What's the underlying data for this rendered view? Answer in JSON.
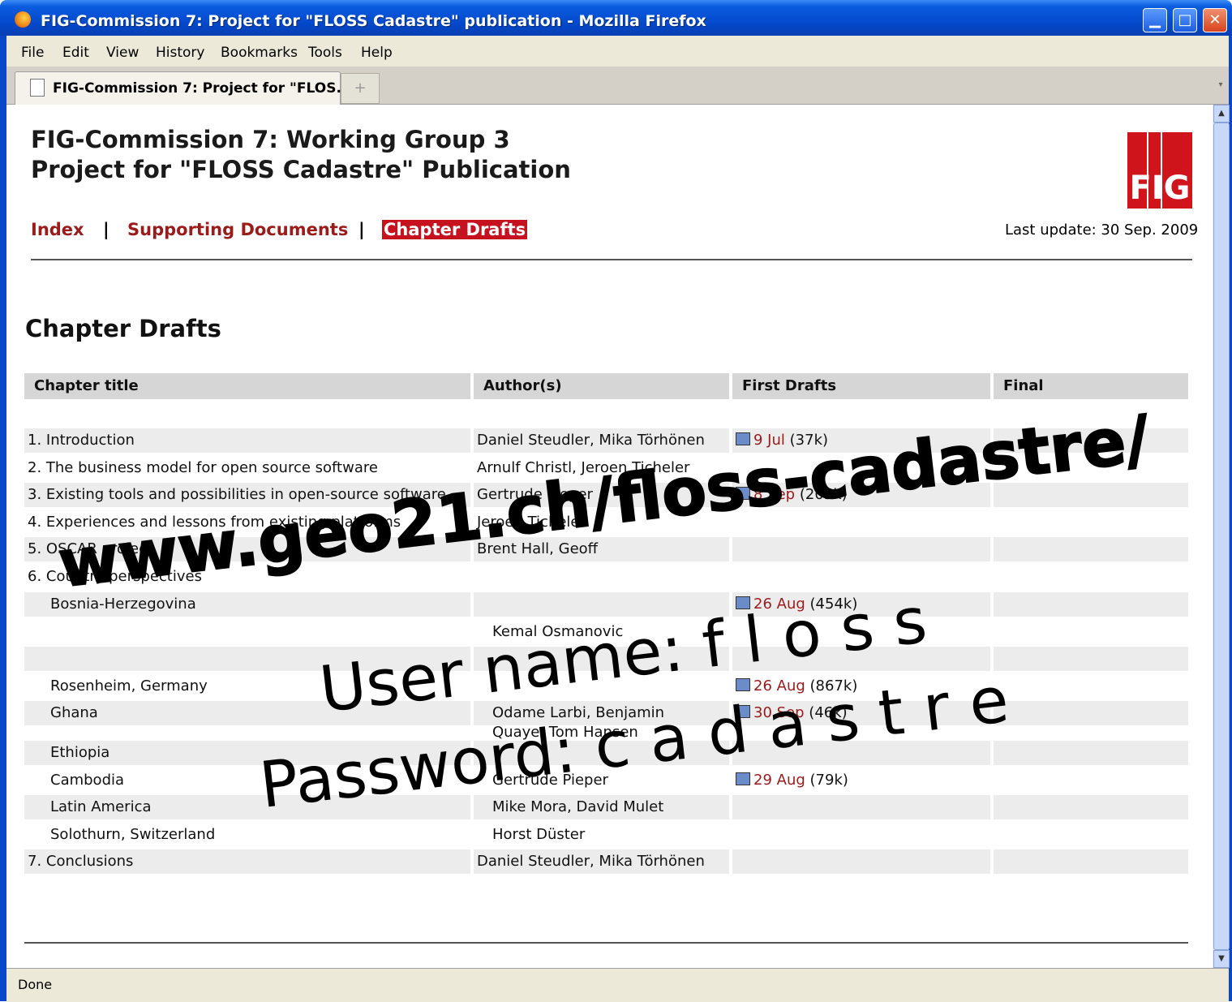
{
  "window": {
    "title": "FIG-Commission 7: Project for \"FLOSS Cadastre\" publication - Mozilla Firefox",
    "minimize": "▁",
    "maximize": "□",
    "close": "✕"
  },
  "menu": [
    "File",
    "Edit",
    "View",
    "History",
    "Bookmarks",
    "Tools",
    "Help"
  ],
  "tab": {
    "label": "FIG-Commission 7: Project for \"FLOS...",
    "new_tab": "+"
  },
  "page": {
    "heading_line1": "FIG-Commission 7: Working Group 3",
    "heading_line2": "Project for \"FLOSS Cadastre\" Publication",
    "logo_text": "FIG",
    "nav": {
      "index": "Index",
      "supporting": "Supporting Documents",
      "drafts": "Chapter Drafts",
      "separator": "|"
    },
    "last_update": "Last update: 30 Sep. 2009",
    "section_title": "Chapter Drafts",
    "columns": [
      "Chapter title",
      "Author(s)",
      "First Drafts",
      "Final"
    ],
    "rows": [
      {
        "title": "1. Introduction",
        "authors": "Daniel Steudler, Mika Törhönen",
        "draft_date": "9 Jul",
        "draft_size": "(37k)",
        "indent": false,
        "shaded": true
      },
      {
        "title": "2. The business model for open source software",
        "authors": "Arnulf Christl, Jeroen Ticheler",
        "draft_date": "",
        "draft_size": "",
        "indent": false,
        "shaded": false
      },
      {
        "title": "3. Existing tools and possibilities in open-source software",
        "authors": "Gertrude Pieper",
        "draft_date": "8 Sep",
        "draft_size": "(205k)",
        "indent": false,
        "shaded": true
      },
      {
        "title": "4. Experiences and lessons from existing platforms",
        "authors": "Jeroen Ticheler",
        "draft_date": "",
        "draft_size": "",
        "indent": false,
        "shaded": false
      },
      {
        "title": "5. OSCAR project",
        "authors": "Brent Hall, Geoff",
        "draft_date": "",
        "draft_size": "",
        "indent": false,
        "shaded": true
      },
      {
        "title": "6. Country perspectives",
        "authors": "",
        "draft_date": "",
        "draft_size": "",
        "indent": false,
        "shaded": false
      },
      {
        "title": "Bosnia-Herzegovina",
        "authors": "",
        "draft_date": "26 Aug",
        "draft_size": "(454k)",
        "indent": true,
        "shaded": true
      },
      {
        "title": "",
        "authors": "Kemal Osmanovic",
        "draft_date": "",
        "draft_size": "",
        "indent": true,
        "shaded": false
      },
      {
        "title": "",
        "authors": "",
        "draft_date": "",
        "draft_size": "",
        "indent": true,
        "shaded": true
      },
      {
        "title": "Rosenheim, Germany",
        "authors": "",
        "draft_date": "26 Aug",
        "draft_size": "(867k)",
        "indent": true,
        "shaded": false
      },
      {
        "title": "Ghana",
        "authors": "Odame Larbi, Benjamin",
        "draft_date": "30 Sep",
        "draft_size": "(46k)",
        "indent": true,
        "shaded": true
      },
      {
        "title": "",
        "authors": "Quaye, Tom Hansen",
        "draft_date": "",
        "draft_size": "",
        "indent": true,
        "shaded": false
      },
      {
        "title": "Ethiopia",
        "authors": "",
        "draft_date": "",
        "draft_size": "",
        "indent": true,
        "shaded": true
      },
      {
        "title": "Cambodia",
        "authors": "Gertrude Pieper",
        "draft_date": "29 Aug",
        "draft_size": "(79k)",
        "indent": true,
        "shaded": false
      },
      {
        "title": "Latin America",
        "authors": "Mike Mora, David Mulet",
        "draft_date": "",
        "draft_size": "",
        "indent": true,
        "shaded": true
      },
      {
        "title": "Solothurn, Switzerland",
        "authors": "Horst Düster",
        "draft_date": "",
        "draft_size": "",
        "indent": true,
        "shaded": false
      },
      {
        "title": "7. Conclusions",
        "authors": "Daniel Steudler, Mika Törhönen",
        "draft_date": "",
        "draft_size": "",
        "indent": false,
        "shaded": true
      }
    ]
  },
  "overlay": {
    "url": "www.geo21.ch/floss-cadastre/",
    "user": "User name: f l o s s",
    "password": "Password: c a d a s t r e"
  },
  "status": "Done"
}
